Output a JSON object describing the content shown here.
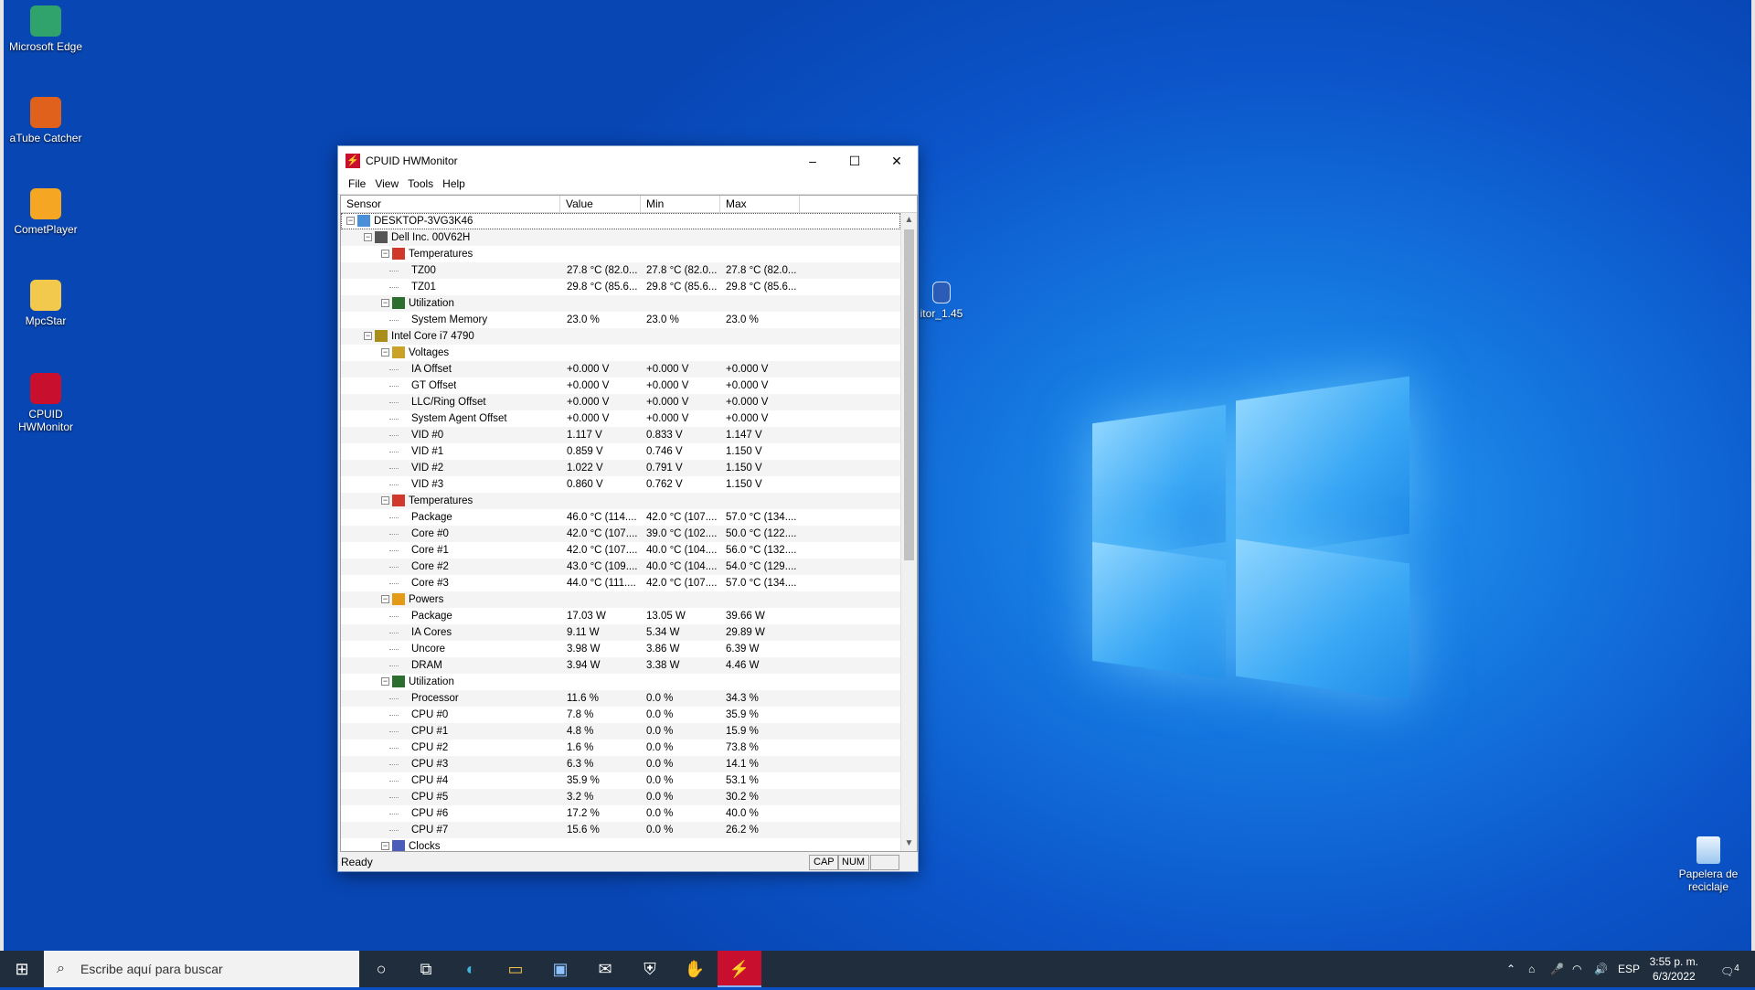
{
  "desktop": {
    "icons": [
      {
        "label": "Microsoft Edge",
        "icon": "edge-icon",
        "color": "#2fa36b"
      },
      {
        "label": "aTube Catcher",
        "icon": "atube-icon",
        "color": "#e0611b"
      },
      {
        "label": "CometPlayer",
        "icon": "cometplayer-icon",
        "color": "#f5a623"
      },
      {
        "label": "MpcStar",
        "icon": "mpcstar-icon",
        "color": "#f2c94c"
      },
      {
        "label": "CPUID HWMonitor",
        "icon": "hwmonitor-icon",
        "color": "#c8102e"
      }
    ],
    "partial_icon_label": "itor_1.45",
    "recycle_bin": "Papelera de reciclaje"
  },
  "window": {
    "title": "CPUID HWMonitor",
    "controls": {
      "minimize": "–",
      "maximize": "☐",
      "close": "✕"
    },
    "menu": [
      "File",
      "View",
      "Tools",
      "Help"
    ],
    "columns": [
      "Sensor",
      "Value",
      "Min",
      "Max"
    ],
    "rows": [
      {
        "level": 0,
        "name": "DESKTOP-3VG3K46",
        "icon": "computer-icon",
        "toggle": "−"
      },
      {
        "level": 1,
        "name": "Dell Inc. 00V62H",
        "icon": "motherboard-icon",
        "toggle": "−"
      },
      {
        "level": 2,
        "name": "Temperatures",
        "icon": "thermometer-icon",
        "toggle": "−"
      },
      {
        "level": 3,
        "name": "TZ00",
        "value": "27.8 °C  (82.0...",
        "min": "27.8 °C  (82.0...",
        "max": "27.8 °C  (82.0..."
      },
      {
        "level": 3,
        "name": "TZ01",
        "value": "29.8 °C  (85.6...",
        "min": "29.8 °C  (85.6...",
        "max": "29.8 °C  (85.6..."
      },
      {
        "level": 2,
        "name": "Utilization",
        "icon": "utilization-icon",
        "toggle": "−"
      },
      {
        "level": 3,
        "name": "System Memory",
        "value": "23.0 %",
        "min": "23.0 %",
        "max": "23.0 %"
      },
      {
        "level": 1,
        "name": "Intel Core i7 4790",
        "icon": "cpu-icon",
        "toggle": "−"
      },
      {
        "level": 2,
        "name": "Voltages",
        "icon": "voltage-icon",
        "toggle": "−"
      },
      {
        "level": 3,
        "name": "IA Offset",
        "value": "+0.000 V",
        "min": "+0.000 V",
        "max": "+0.000 V"
      },
      {
        "level": 3,
        "name": "GT Offset",
        "value": "+0.000 V",
        "min": "+0.000 V",
        "max": "+0.000 V"
      },
      {
        "level": 3,
        "name": "LLC/Ring Offset",
        "value": "+0.000 V",
        "min": "+0.000 V",
        "max": "+0.000 V"
      },
      {
        "level": 3,
        "name": "System Agent Offset",
        "value": "+0.000 V",
        "min": "+0.000 V",
        "max": "+0.000 V"
      },
      {
        "level": 3,
        "name": "VID #0",
        "value": "1.117 V",
        "min": "0.833 V",
        "max": "1.147 V"
      },
      {
        "level": 3,
        "name": "VID #1",
        "value": "0.859 V",
        "min": "0.746 V",
        "max": "1.150 V"
      },
      {
        "level": 3,
        "name": "VID #2",
        "value": "1.022 V",
        "min": "0.791 V",
        "max": "1.150 V"
      },
      {
        "level": 3,
        "name": "VID #3",
        "value": "0.860 V",
        "min": "0.762 V",
        "max": "1.150 V"
      },
      {
        "level": 2,
        "name": "Temperatures",
        "icon": "thermometer-icon",
        "toggle": "−"
      },
      {
        "level": 3,
        "name": "Package",
        "value": "46.0 °C  (114....",
        "min": "42.0 °C  (107....",
        "max": "57.0 °C  (134...."
      },
      {
        "level": 3,
        "name": "Core #0",
        "value": "42.0 °C  (107....",
        "min": "39.0 °C  (102....",
        "max": "50.0 °C  (122...."
      },
      {
        "level": 3,
        "name": "Core #1",
        "value": "42.0 °C  (107....",
        "min": "40.0 °C  (104....",
        "max": "56.0 °C  (132...."
      },
      {
        "level": 3,
        "name": "Core #2",
        "value": "43.0 °C  (109....",
        "min": "40.0 °C  (104....",
        "max": "54.0 °C  (129...."
      },
      {
        "level": 3,
        "name": "Core #3",
        "value": "44.0 °C  (111....",
        "min": "42.0 °C  (107....",
        "max": "57.0 °C  (134...."
      },
      {
        "level": 2,
        "name": "Powers",
        "icon": "power-icon",
        "toggle": "−"
      },
      {
        "level": 3,
        "name": "Package",
        "value": "17.03 W",
        "min": "13.05 W",
        "max": "39.66 W"
      },
      {
        "level": 3,
        "name": "IA Cores",
        "value": "9.11 W",
        "min": "5.34 W",
        "max": "29.89 W"
      },
      {
        "level": 3,
        "name": "Uncore",
        "value": "3.98 W",
        "min": "3.86 W",
        "max": "6.39 W"
      },
      {
        "level": 3,
        "name": "DRAM",
        "value": "3.94 W",
        "min": "3.38 W",
        "max": "4.46 W"
      },
      {
        "level": 2,
        "name": "Utilization",
        "icon": "utilization-icon",
        "toggle": "−"
      },
      {
        "level": 3,
        "name": "Processor",
        "value": "11.6 %",
        "min": "0.0 %",
        "max": "34.3 %"
      },
      {
        "level": 3,
        "name": "CPU #0",
        "value": "7.8 %",
        "min": "0.0 %",
        "max": "35.9 %"
      },
      {
        "level": 3,
        "name": "CPU #1",
        "value": "4.8 %",
        "min": "0.0 %",
        "max": "15.9 %"
      },
      {
        "level": 3,
        "name": "CPU #2",
        "value": "1.6 %",
        "min": "0.0 %",
        "max": "73.8 %"
      },
      {
        "level": 3,
        "name": "CPU #3",
        "value": "6.3 %",
        "min": "0.0 %",
        "max": "14.1 %"
      },
      {
        "level": 3,
        "name": "CPU #4",
        "value": "35.9 %",
        "min": "0.0 %",
        "max": "53.1 %"
      },
      {
        "level": 3,
        "name": "CPU #5",
        "value": "3.2 %",
        "min": "0.0 %",
        "max": "30.2 %"
      },
      {
        "level": 3,
        "name": "CPU #6",
        "value": "17.2 %",
        "min": "0.0 %",
        "max": "40.0 %"
      },
      {
        "level": 3,
        "name": "CPU #7",
        "value": "15.6 %",
        "min": "0.0 %",
        "max": "26.2 %"
      },
      {
        "level": 2,
        "name": "Clocks",
        "icon": "clock-icon",
        "toggle": "−"
      }
    ],
    "status": {
      "text": "Ready",
      "cap": "CAP",
      "num": "NUM"
    }
  },
  "taskbar": {
    "search_placeholder": "Escribe aquí para buscar",
    "apps": [
      "cortana-icon",
      "task-view-icon",
      "edge-icon",
      "file-explorer-icon",
      "store-icon",
      "mail-icon",
      "security-icon",
      "atube-icon",
      "hwmonitor-icon"
    ],
    "language": "ESP",
    "time": "3:55 p. m.",
    "date": "6/3/2022",
    "notification_count": "4"
  }
}
